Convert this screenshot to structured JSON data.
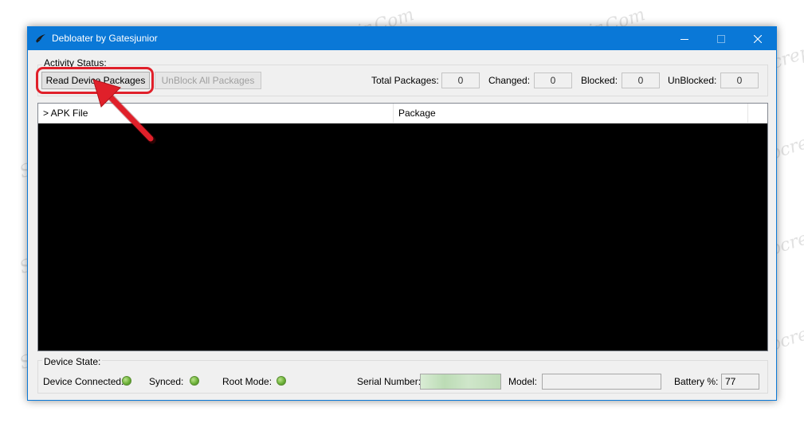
{
  "window": {
    "title": "Debloater by Gatesjunior"
  },
  "activity": {
    "group_label": "Activity Status:",
    "read_button": "Read Device Packages",
    "unblock_button": "UnBlock All Packages",
    "total_label": "Total Packages:",
    "total_value": "0",
    "changed_label": "Changed:",
    "changed_value": "0",
    "blocked_label": "Blocked:",
    "blocked_value": "0",
    "unblocked_label": "UnBlocked:",
    "unblocked_value": "0"
  },
  "table": {
    "columns": [
      "> APK File",
      "Package"
    ]
  },
  "device": {
    "group_label": "Device State:",
    "connected_label": "Device Connected:",
    "synced_label": "Synced:",
    "root_label": "Root Mode:",
    "serial_label": "Serial Number:",
    "serial_value": "",
    "model_label": "Model:",
    "model_value": "",
    "battery_label": "Battery %:",
    "battery_value": "77"
  },
  "watermark": "Soringpcrepair.Com",
  "icons": {
    "app": "app-logo-icon",
    "minimize": "minimize-icon",
    "maximize": "maximize-icon",
    "close": "close-icon",
    "status_led": "status-led-icon"
  },
  "colors": {
    "titlebar": "#0a78d7",
    "annotation": "#e0202a",
    "led_green": "#6fb33a",
    "list_background": "#000000"
  }
}
